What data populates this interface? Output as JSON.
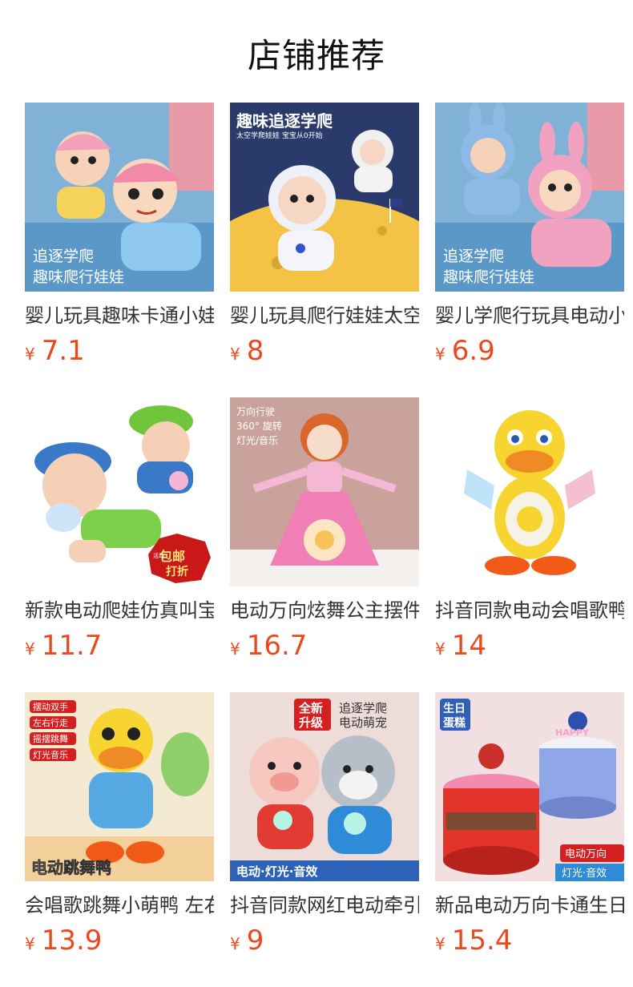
{
  "section": {
    "title": "店铺推荐"
  },
  "products": [
    {
      "name": "婴儿玩具趣味卡通小娃娃",
      "currency": "¥",
      "price": "7.1",
      "overlay": [
        "追逐学爬",
        "趣味爬行娃娃"
      ]
    },
    {
      "name": "婴儿玩具爬行娃娃太空",
      "currency": "¥",
      "price": "8",
      "overlay": [
        "趣味追逐学爬",
        "太空学爬娃娃 宝宝从0开始"
      ]
    },
    {
      "name": "婴儿学爬行玩具电动小",
      "currency": "¥",
      "price": "6.9",
      "overlay": [
        "追逐学爬",
        "趣味爬行娃娃"
      ]
    },
    {
      "name": "新款电动爬娃仿真叫宝宝",
      "currency": "¥",
      "price": "11.7",
      "overlay": [
        "包邮",
        "打折",
        "活动"
      ]
    },
    {
      "name": "电动万向炫舞公主摆件",
      "currency": "¥",
      "price": "16.7",
      "overlay": [
        "万向行驶",
        "360° 旋转",
        "灯光/音乐"
      ]
    },
    {
      "name": "抖音同款电动会唱歌鸭",
      "currency": "¥",
      "price": "14",
      "overlay": []
    },
    {
      "name": "会唱歌跳舞小萌鸭 左右",
      "currency": "¥",
      "price": "13.9",
      "overlay": [
        "摆动双手",
        "左右行走",
        "摇摆跳舞",
        "灯光音乐",
        "电动跳舞鸭"
      ]
    },
    {
      "name": "抖音同款网红电动牵引",
      "currency": "¥",
      "price": "9",
      "overlay": [
        "全新",
        "升级",
        "追逐学爬",
        "电动萌宠",
        "电动·灯光·音效"
      ]
    },
    {
      "name": "新品电动万向卡通生日",
      "currency": "¥",
      "price": "15.4",
      "overlay": [
        "生日",
        "蛋糕",
        "电动万向",
        "灯光·音效",
        "HAPPY"
      ]
    }
  ]
}
